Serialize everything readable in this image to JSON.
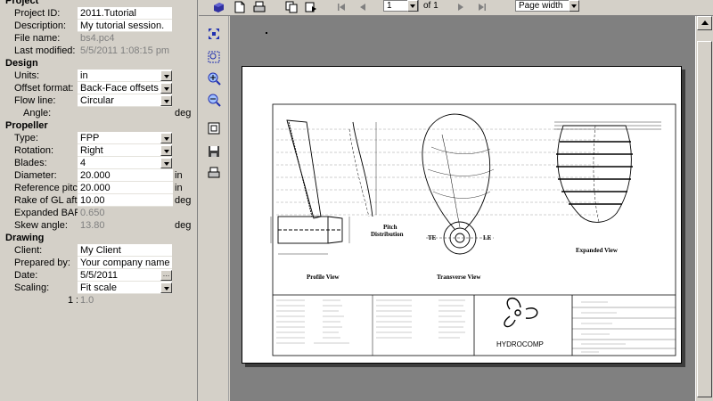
{
  "sections": {
    "project": "Project",
    "design": "Design",
    "propeller": "Propeller",
    "drawing": "Drawing"
  },
  "project": {
    "project_id": {
      "label": "Project ID:",
      "value": "2011.Tutorial"
    },
    "description": {
      "label": "Description:",
      "value": "My tutorial session."
    },
    "file_name": {
      "label": "File name:",
      "value": "bs4.pc4"
    },
    "last_modified": {
      "label": "Last modified:",
      "value": "5/5/2011 1:08:15 pm"
    }
  },
  "design": {
    "units": {
      "label": "Units:",
      "value": "in"
    },
    "offset_format": {
      "label": "Offset format:",
      "value": "Back-Face offsets"
    },
    "flow_line": {
      "label": "Flow line:",
      "value": "Circular"
    },
    "angle": {
      "label": "Angle:",
      "value": "",
      "unit": "deg"
    }
  },
  "propeller": {
    "type": {
      "label": "Type:",
      "value": "FPP"
    },
    "rotation": {
      "label": "Rotation:",
      "value": "Right"
    },
    "blades": {
      "label": "Blades:",
      "value": "4"
    },
    "diameter": {
      "label": "Diameter:",
      "value": "20.000",
      "unit": "in"
    },
    "reference_pitch": {
      "label": "Reference pitch:",
      "value": "20.000",
      "unit": "in"
    },
    "rake": {
      "label": "Rake of GL aft:",
      "value": "10.00",
      "unit": "deg"
    },
    "expanded_bar": {
      "label": "Expanded BAR:",
      "value": "0.650"
    },
    "skew_angle": {
      "label": "Skew angle:",
      "value": "13.80",
      "unit": "deg"
    }
  },
  "drawing": {
    "client": {
      "label": "Client:",
      "value": "My Client"
    },
    "prepared_by": {
      "label": "Prepared by:",
      "value": "Your company name h..."
    },
    "date": {
      "label": "Date:",
      "value": "5/5/2011"
    },
    "scaling": {
      "label": "Scaling:",
      "value": "Fit scale"
    },
    "ratio_left": "1 :",
    "ratio_value": "1.0"
  },
  "toolbar": {
    "page_number": "1",
    "of_pages": "of 1",
    "zoom": "Page width"
  },
  "drawing_sheet": {
    "profile_view": "Profile View",
    "pitch_distribution_1": "Pitch",
    "pitch_distribution_2": "Distribution",
    "transverse_view": "Transverse View",
    "expanded_view": "Expanded View",
    "te": "TE",
    "le": "LE",
    "logo_text": "HYDROCOMP"
  },
  "colors": {
    "panel": "#d4d0c8",
    "preview_bg": "#808080",
    "paper": "#ffffff"
  }
}
